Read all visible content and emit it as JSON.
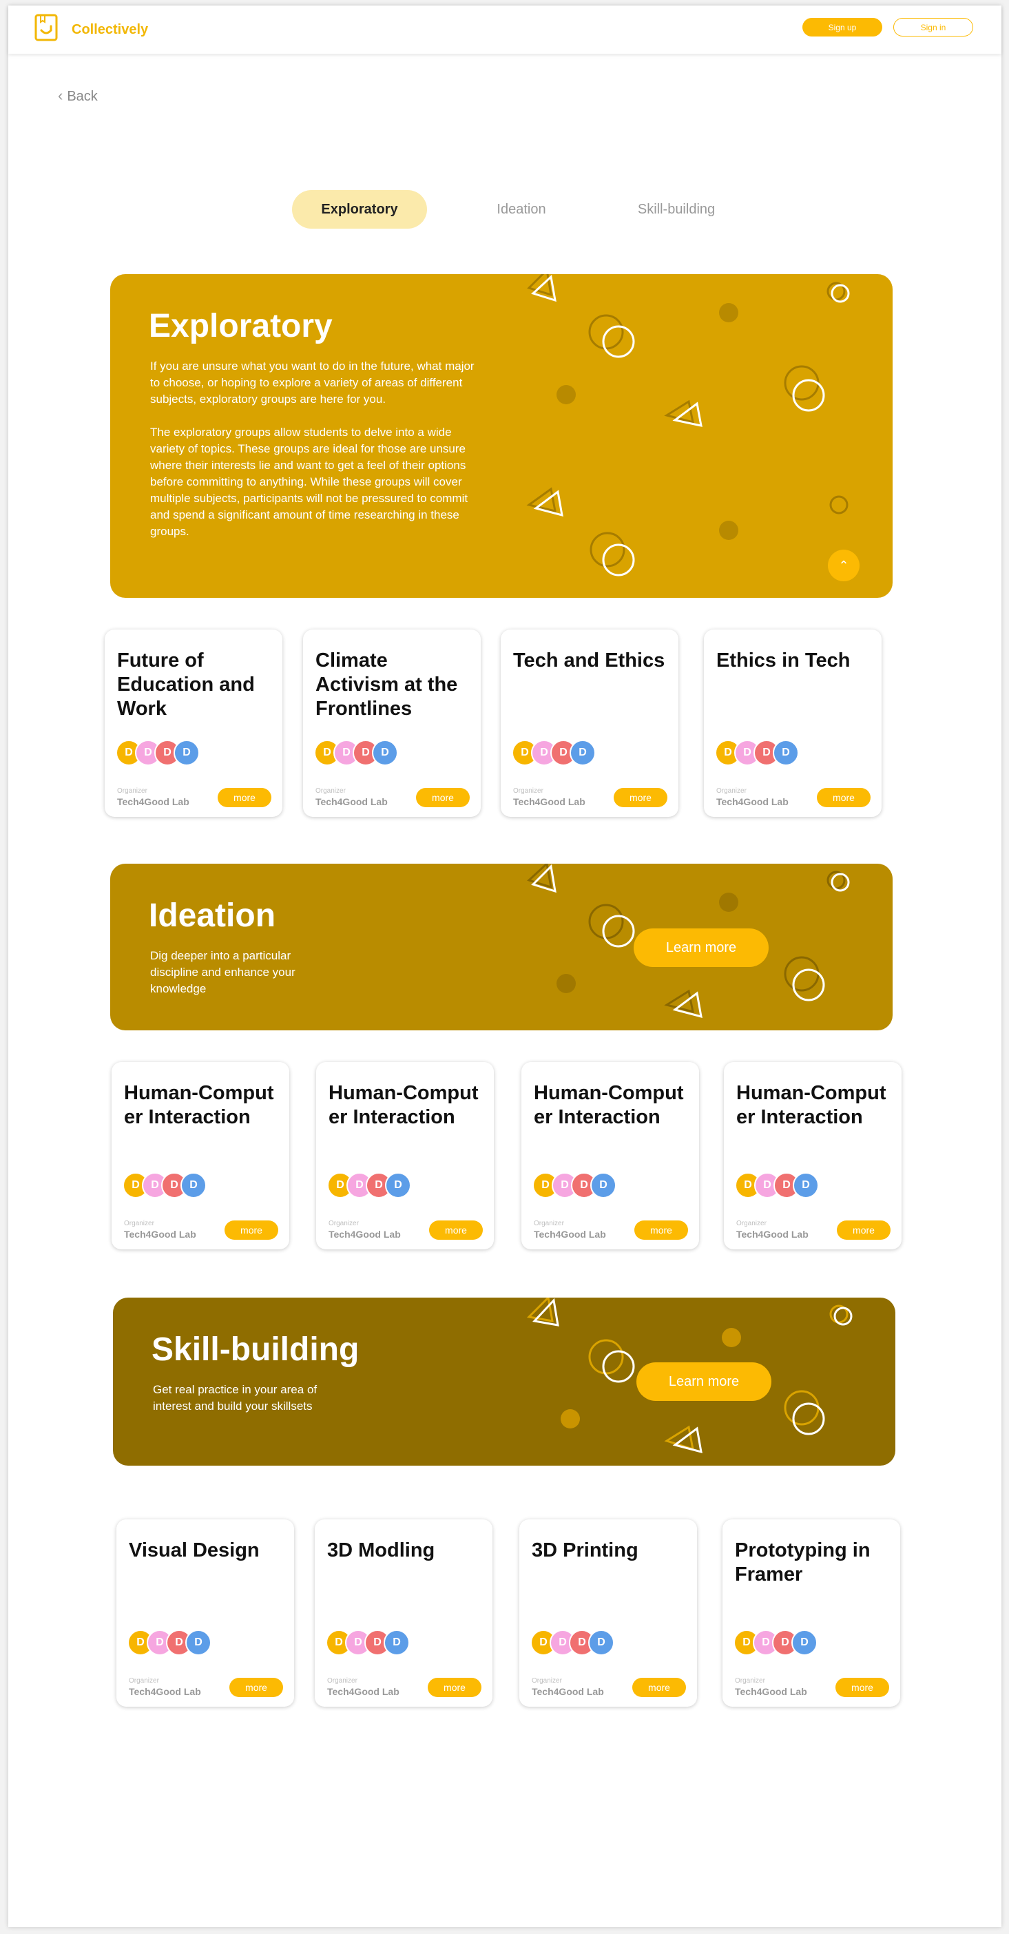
{
  "header": {
    "brand": "Collectively",
    "signup_label": "Sign up",
    "signin_label": "Sign in"
  },
  "nav": {
    "back_label": "Back"
  },
  "tabs": [
    {
      "label": "Exploratory",
      "active": true
    },
    {
      "label": "Ideation",
      "active": false
    },
    {
      "label": "Skill-building",
      "active": false
    }
  ],
  "colors": {
    "accent": "#fcba03",
    "exploratory_bg": "#d9a300",
    "ideation_bg": "#b98c00",
    "skill_bg": "#8f6d00",
    "avatars": [
      "#f7b500",
      "#f6a6e0",
      "#f07070",
      "#5c9de8"
    ]
  },
  "sections": [
    {
      "id": "exploratory",
      "title": "Exploratory",
      "paragraphs": [
        "If you are unsure what you want to do in the future, what major to choose, or hoping to explore a variety of areas of different subjects, exploratory groups are here for you.",
        "The exploratory groups allow students to delve into a wide variety of topics. These groups are ideal for those are unsure where their interests lie and want to get a feel of their options before committing to anything. While these groups will cover multiple subjects, participants will not be pressured to commit and spend a significant amount of time researching in these groups."
      ],
      "cards": [
        {
          "title": "Future of Education and Work",
          "organizer_label": "Organizer",
          "organizer": "Tech4Good Lab",
          "more_label": "more",
          "avatars": [
            "D",
            "D",
            "D",
            "D"
          ]
        },
        {
          "title": "Climate Activism at the Frontlines",
          "organizer_label": "Organizer",
          "organizer": "Tech4Good Lab",
          "more_label": "more",
          "avatars": [
            "D",
            "D",
            "D",
            "D"
          ]
        },
        {
          "title": "Tech and Ethics",
          "organizer_label": "Organizer",
          "organizer": "Tech4Good Lab",
          "more_label": "more",
          "avatars": [
            "D",
            "D",
            "D",
            "D"
          ]
        },
        {
          "title": "Ethics in Tech",
          "organizer_label": "Organizer",
          "organizer": "Tech4Good Lab",
          "more_label": "more",
          "avatars": [
            "D",
            "D",
            "D",
            "D"
          ]
        }
      ]
    },
    {
      "id": "ideation",
      "title": "Ideation",
      "description": "Dig deeper into a particular discipline and enhance your knowledge",
      "learn_more_label": "Learn more",
      "cards": [
        {
          "title": "Human-Comput er Interaction",
          "organizer_label": "Organizer",
          "organizer": "Tech4Good Lab",
          "more_label": "more",
          "avatars": [
            "D",
            "D",
            "D",
            "D"
          ]
        },
        {
          "title": "Human-Comput er Interaction",
          "organizer_label": "Organizer",
          "organizer": "Tech4Good Lab",
          "more_label": "more",
          "avatars": [
            "D",
            "D",
            "D",
            "D"
          ]
        },
        {
          "title": "Human-Comput er Interaction",
          "organizer_label": "Organizer",
          "organizer": "Tech4Good Lab",
          "more_label": "more",
          "avatars": [
            "D",
            "D",
            "D",
            "D"
          ]
        },
        {
          "title": "Human-Comput er Interaction",
          "organizer_label": "Organizer",
          "organizer": "Tech4Good Lab",
          "more_label": "more",
          "avatars": [
            "D",
            "D",
            "D",
            "D"
          ]
        }
      ]
    },
    {
      "id": "skill-building",
      "title": "Skill-building",
      "description": "Get real practice in your area of interest and build your skillsets",
      "learn_more_label": "Learn more",
      "cards": [
        {
          "title": "Visual Design",
          "organizer_label": "Organizer",
          "organizer": "Tech4Good Lab",
          "more_label": "more",
          "avatars": [
            "D",
            "D",
            "D",
            "D"
          ]
        },
        {
          "title": "3D Modling",
          "organizer_label": "Organizer",
          "organizer": "Tech4Good Lab",
          "more_label": "more",
          "avatars": [
            "D",
            "D",
            "D",
            "D"
          ]
        },
        {
          "title": "3D Printing",
          "organizer_label": "Organizer",
          "organizer": "Tech4Good Lab",
          "more_label": "more",
          "avatars": [
            "D",
            "D",
            "D",
            "D"
          ]
        },
        {
          "title": "Prototyping in Framer",
          "organizer_label": "Organizer",
          "organizer": "Tech4Good Lab",
          "more_label": "more",
          "avatars": [
            "D",
            "D",
            "D",
            "D"
          ]
        }
      ]
    }
  ]
}
